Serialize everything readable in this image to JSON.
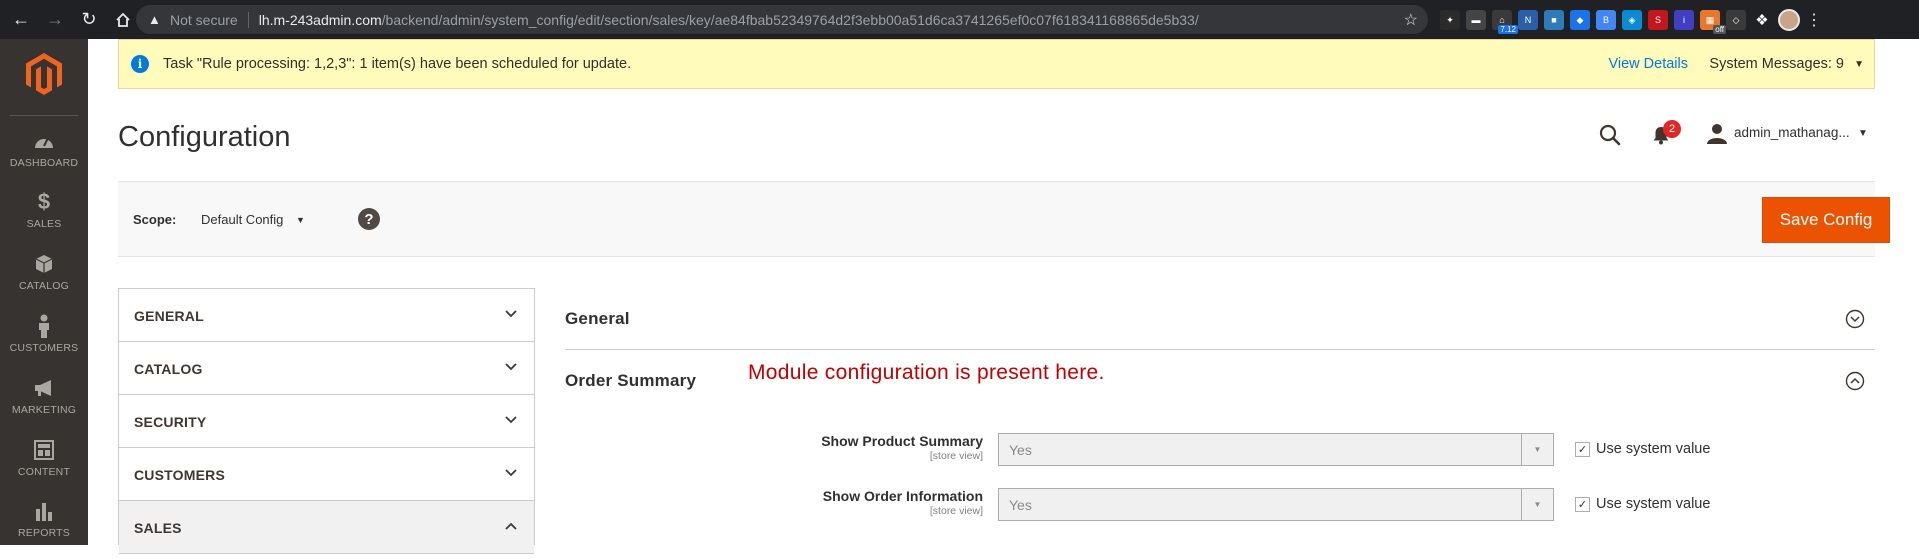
{
  "browser": {
    "security_label": "Not secure",
    "url_host": "lh.m-243admin.com",
    "url_path": "/backend/admin/system_config/edit/section/sales/key/ae84fbab52349764d2f3ebb00a51d6ca3741265ef0c07f618341168865de5b33/",
    "ext_badge_1": "7.12",
    "ext_badge_2": "off"
  },
  "sidebar": {
    "items": [
      {
        "label": "DASHBOARD",
        "icon": "dashboard-icon"
      },
      {
        "label": "SALES",
        "icon": "dollar-icon"
      },
      {
        "label": "CATALOG",
        "icon": "cube-icon"
      },
      {
        "label": "CUSTOMERS",
        "icon": "person-icon"
      },
      {
        "label": "MARKETING",
        "icon": "megaphone-icon"
      },
      {
        "label": "CONTENT",
        "icon": "layout-icon"
      },
      {
        "label": "REPORTS",
        "icon": "bar-chart-icon"
      }
    ]
  },
  "message": {
    "text": "Task \"Rule processing: 1,2,3\": 1 item(s) have been scheduled for update.",
    "view_details": "View Details",
    "system_messages": "System Messages: 9"
  },
  "header": {
    "title": "Configuration",
    "notification_count": "2",
    "username": "admin_mathanag..."
  },
  "scope": {
    "label": "Scope:",
    "value": "Default Config",
    "help": "?",
    "save_label": "Save Config"
  },
  "left_nav": {
    "sections": [
      "GENERAL",
      "CATALOG",
      "SECURITY",
      "CUSTOMERS",
      "SALES"
    ]
  },
  "config": {
    "sections": [
      "General",
      "Order Summary"
    ],
    "annotation": "Module configuration is present here.",
    "fields": [
      {
        "label": "Show Product Summary",
        "scope": "[store view]",
        "value": "Yes",
        "checkbox_label": "Use system value",
        "checked": true
      },
      {
        "label": "Show Order Information",
        "scope": "[store view]",
        "value": "Yes",
        "checkbox_label": "Use system value",
        "checked": true
      }
    ]
  },
  "colors": {
    "accent": "#eb5202",
    "sidebar_bg": "#373330",
    "link": "#007bdb",
    "annotation": "#c00000"
  }
}
